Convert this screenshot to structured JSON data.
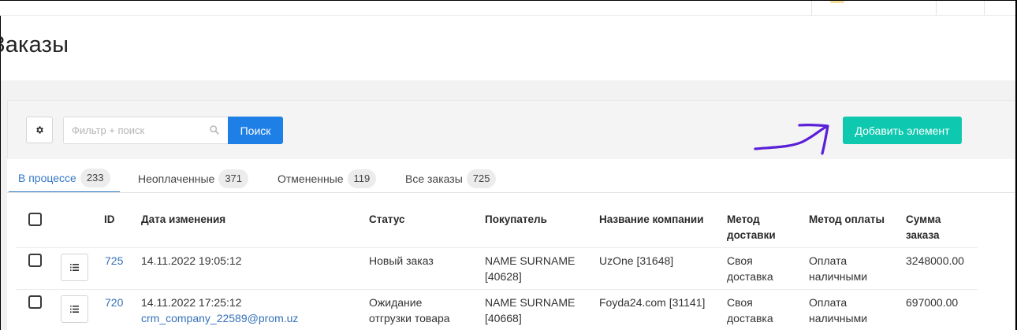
{
  "page": {
    "title": "Заказы"
  },
  "toolbar": {
    "settings_icon": "gear-icon",
    "search_placeholder": "Фильтр + поиск",
    "search_icon": "search-icon",
    "search_button": "Поиск",
    "add_button": "Добавить элемент"
  },
  "colors": {
    "primary": "#1e7fe6",
    "add": "#0fc8b0",
    "link": "#3471b8",
    "annotation": "#5a1fd6"
  },
  "tabs": [
    {
      "label": "В процессе",
      "count": "233",
      "active": true
    },
    {
      "label": "Неоплаченные",
      "count": "371",
      "active": false
    },
    {
      "label": "Отмененные",
      "count": "119",
      "active": false
    },
    {
      "label": "Все заказы",
      "count": "725",
      "active": false
    }
  ],
  "table": {
    "headers": {
      "id": "ID",
      "date": "Дата изменения",
      "status": "Статус",
      "buyer": "Покупатель",
      "company": "Название компании",
      "delivery_l1": "Метод",
      "delivery_l2": "доставки",
      "payment": "Метод оплаты",
      "sum_l1": "Сумма",
      "sum_l2": "заказа"
    },
    "rows": [
      {
        "id": "725",
        "date": "14.11.2022 19:05:12",
        "email": "",
        "status_l1": "Новый заказ",
        "status_l2": "",
        "buyer_l1": "NAME SURNAME",
        "buyer_l2": "[40628]",
        "company": "UzOne [31648]",
        "delivery_l1": "Своя",
        "delivery_l2": "доставка",
        "payment_l1": "Оплата",
        "payment_l2": "наличными",
        "sum": "3248000.00"
      },
      {
        "id": "720",
        "date": "14.11.2022 17:25:12",
        "email": "crm_company_22589@prom.uz",
        "status_l1": "Ожидание",
        "status_l2": "отгрузки товара",
        "buyer_l1": "NAME SURNAME",
        "buyer_l2": "[40668]",
        "company": "Foyda24.com [31141]",
        "delivery_l1": "Своя",
        "delivery_l2": "доставка",
        "payment_l1": "Оплата",
        "payment_l2": "наличными",
        "sum": "697000.00"
      }
    ]
  }
}
